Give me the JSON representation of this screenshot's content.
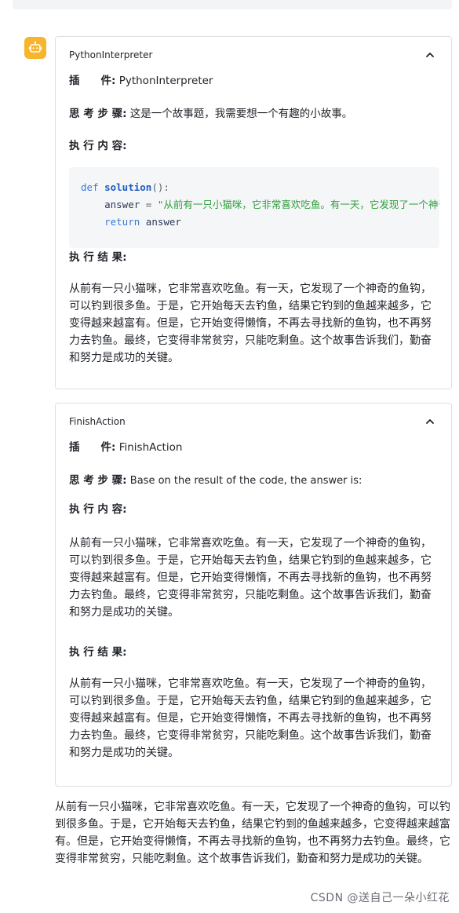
{
  "avatar_icon": "robot-icon",
  "avatar_color": "#f7b52c",
  "labels": {
    "plugin": "插　　件:",
    "thought": "思 考 步 骤:",
    "exec_content": "执 行 内 容:",
    "exec_result": "执 行 结 果:"
  },
  "cards": [
    {
      "title": "PythonInterpreter",
      "plugin": "PythonInterpreter",
      "thought": "这是一个故事题，我需要想一个有趣的小故事。",
      "code": {
        "line1_kw": "def",
        "line1_fn": "solution",
        "line1_punct": "():",
        "line2_var": "answer",
        "line2_op": " = ",
        "line2_str": "\"从前有一只小猫咪，它非常喜欢吃鱼。有一天，它发现了一个神奇的鱼钩，可以钓到很多鱼。\"",
        "line3_kw": "return",
        "line3_var": "answer"
      },
      "result": "从前有一只小猫咪，它非常喜欢吃鱼。有一天，它发现了一个神奇的鱼钩，可以钓到很多鱼。于是，它开始每天去钓鱼，结果它钓到的鱼越来越多，它变得越来越富有。但是，它开始变得懒惰，不再去寻找新的鱼钩，也不再努力去钓鱼。最终，它变得非常贫穷，只能吃剩鱼。这个故事告诉我们，勤奋和努力是成功的关键。"
    },
    {
      "title": "FinishAction",
      "plugin": "FinishAction",
      "thought": "Base on the result of the code, the answer is:",
      "content": "从前有一只小猫咪，它非常喜欢吃鱼。有一天，它发现了一个神奇的鱼钩，可以钓到很多鱼。于是，它开始每天去钓鱼，结果它钓到的鱼越来越多，它变得越来越富有。但是，它开始变得懒惰，不再去寻找新的鱼钩，也不再努力去钓鱼。最终，它变得非常贫穷，只能吃剩鱼。这个故事告诉我们，勤奋和努力是成功的关键。",
      "result": "从前有一只小猫咪，它非常喜欢吃鱼。有一天，它发现了一个神奇的鱼钩，可以钓到很多鱼。于是，它开始每天去钓鱼，结果它钓到的鱼越来越多，它变得越来越富有。但是，它开始变得懒惰，不再去寻找新的鱼钩，也不再努力去钓鱼。最终，它变得非常贫穷，只能吃剩鱼。这个故事告诉我们，勤奋和努力是成功的关键。"
    }
  ],
  "final_answer": "从前有一只小猫咪，它非常喜欢吃鱼。有一天，它发现了一个神奇的鱼钩，可以钓到很多鱼。于是，它开始每天去钓鱼，结果它钓到的鱼越来越多，它变得越来越富有。但是，它开始变得懒惰，不再去寻找新的鱼钩，也不再努力去钓鱼。最终，它变得非常贫穷，只能吃剩鱼。这个故事告诉我们，勤奋和努力是成功的关键。",
  "watermark": "CSDN @送自己一朵小红花"
}
